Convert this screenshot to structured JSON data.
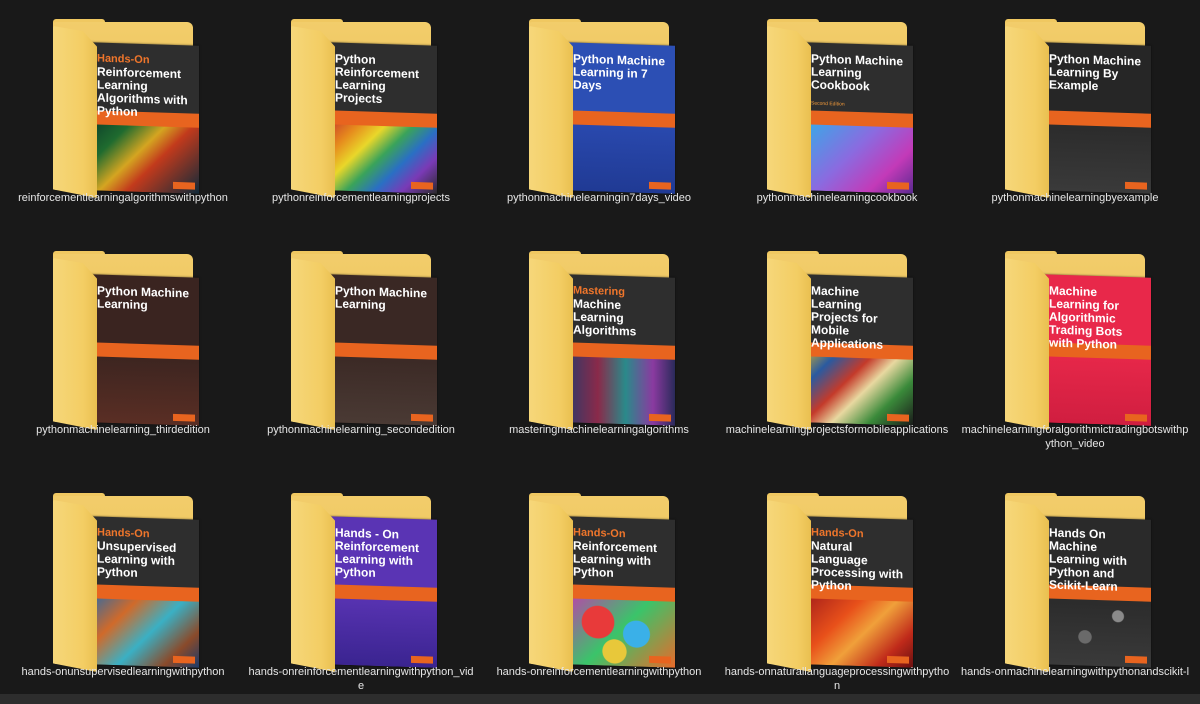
{
  "folders": [
    {
      "label": "reinforcementlearningalgorithmswithpython",
      "kicker": "Hands-On",
      "title": "Reinforcement Learning Algorithms with Python",
      "sub": "",
      "edition": "",
      "theme": {
        "bg": "#2e2e2e",
        "art": "linear-gradient(135deg,#0a3a2a 0%,#1f6b2f 25%,#d4a521 45%,#c23a1c 60%,#0f2a3a 100%)",
        "strip": "#2e2e2e"
      }
    },
    {
      "label": "pythonreinforcementlearningprojects",
      "kicker": "",
      "title": "Python Reinforcement Learning Projects",
      "sub": "",
      "edition": "",
      "theme": {
        "bg": "#2e2e2e",
        "art": "linear-gradient(135deg,#c4302b 0%,#e68a1d 20%,#e9d72a 35%,#3aa35a 50%,#2a6fc4 65%,#7a3ab6 80%,#2a2a2a 100%)",
        "strip": "#2e2e2e"
      }
    },
    {
      "label": "pythonmachinelearningin7days_video",
      "kicker": "",
      "title": "Python Machine Learning in 7 Days",
      "sub": "",
      "edition": "",
      "theme": {
        "bg": "#2c4fb4",
        "art": "linear-gradient(180deg,#2a4ab0 0%,#203a94 100%)",
        "strip": "#2c4fb4"
      }
    },
    {
      "label": "pythonmachinelearningcookbook",
      "kicker": "",
      "title": "Python Machine Learning Cookbook",
      "sub": "",
      "edition": "Second Edition",
      "theme": {
        "bg": "#2e2e2e",
        "art": "linear-gradient(135deg,#2fb0e8 0%,#8a6be0 45%,#c33ab8 75%,#5a2a90 100%)",
        "strip": "#2e2e2e"
      }
    },
    {
      "label": "pythonmachinelearningbyexample",
      "kicker": "",
      "title": "Python Machine Learning By Example",
      "sub": "",
      "edition": "",
      "theme": {
        "bg": "#262626",
        "art": "linear-gradient(180deg,#2a2a2a 0%,#3a3a3a 100%)",
        "strip": "#262626"
      }
    },
    {
      "label": "pythonmachinelearning_thirdedition",
      "kicker": "",
      "title": "Python Machine Learning",
      "sub": "",
      "edition": "",
      "theme": {
        "bg": "#3a2420",
        "art": "linear-gradient(180deg,#3a2420 0%,#5a2e24 100%)",
        "strip": "#3a2420"
      }
    },
    {
      "label": "pythonmachinelearning_secondedition",
      "kicker": "",
      "title": "Python Machine Learning",
      "sub": "",
      "edition": "",
      "theme": {
        "bg": "#3a2824",
        "art": "linear-gradient(180deg,#3a2824 0%,#4a3a34 100%)",
        "strip": "#3a2824"
      }
    },
    {
      "label": "masteringmachinelearningalgorithms",
      "kicker": "Mastering",
      "title": "Machine Learning Algorithms",
      "sub": "",
      "edition": "",
      "theme": {
        "bg": "#2e2e2e",
        "art": "linear-gradient(90deg,#2a3a6a 0%,#8a2a4a 30%,#2a8a8a 55%,#8a3aa0 80%,#2a2a5a 100%)",
        "strip": "#2e2e2e"
      }
    },
    {
      "label": "machinelearningprojectsformobileapplications",
      "kicker": "",
      "title": "Machine Learning Projects for Mobile Applications",
      "sub": "",
      "edition": "",
      "theme": {
        "bg": "#2e2e2e",
        "art": "linear-gradient(135deg,#d4b02a 0%,#2a5aa0 20%,#c43a2a 40%,#e8d8a0 55%,#3a8a3a 75%,#1a1a1a 100%)",
        "strip": "#2e2e2e"
      }
    },
    {
      "label": "machinelearningforalgorithmictradingbotswithpython_video",
      "kicker": "",
      "title": "Machine Learning for Algorithmic Trading Bots with Python",
      "sub": "",
      "edition": "",
      "theme": {
        "bg": "#e8284a",
        "art": "linear-gradient(180deg,#e8284a 0%,#d01e40 100%)",
        "strip": "#e8284a"
      }
    },
    {
      "label": "hands-onunsupervisedlearningwithpython",
      "kicker": "Hands-On",
      "title": "Unsupervised Learning with Python",
      "sub": "",
      "edition": "",
      "theme": {
        "bg": "#2e2e2e",
        "art": "linear-gradient(135deg,#1f6ab0 0%,#d06a2a 30%,#3ab0c4 55%,#8a4a2a 80%,#1a3a6a 100%)",
        "strip": "#2e2e2e"
      }
    },
    {
      "label": "hands-onreinforcementlearningwithpython_vide",
      "kicker": "",
      "title": "Hands - On Reinforcement Learning with Python",
      "sub": "",
      "edition": "",
      "theme": {
        "bg": "#5a34b4",
        "art": "linear-gradient(180deg,#5a34b4 0%,#3a2490 100%)",
        "strip": "#5a34b4"
      }
    },
    {
      "label": "hands-onreinforcementlearningwithpython",
      "kicker": "Hands-On",
      "title": "Reinforcement Learning with Python",
      "sub": "",
      "edition": "",
      "theme": {
        "bg": "#2e2e2e",
        "art": "radial-gradient(circle at 30% 40%,#e83a3a 0 18%,transparent 19%),radial-gradient(circle at 65% 55%,#3ab0e8 0 16%,transparent 17%),radial-gradient(circle at 45% 80%,#e8c83a 0 14%,transparent 15%),linear-gradient(135deg,#c43ab0 0%,#3ac46a 50%,#e86a2a 100%)",
        "strip": "#2e2e2e"
      }
    },
    {
      "label": "hands-onnaturallanguageprocessingwithpython",
      "kicker": "Hands-On",
      "title": "Natural Language Processing with Python",
      "sub": "",
      "edition": "",
      "theme": {
        "bg": "#2e2e2e",
        "art": "linear-gradient(135deg,#a01a1a 0%,#e8501a 35%,#f0a03a 55%,#c02a1a 80%,#6a1010 100%)",
        "strip": "#2e2e2e"
      }
    },
    {
      "label": "hands-onmachinelearningwithpythonandscikit-l",
      "kicker": "",
      "title": "Hands On Machine Learning with Python and Scikit-Learn",
      "sub": "",
      "edition": "",
      "theme": {
        "bg": "#2a2a2a",
        "art": "radial-gradient(circle at 70% 30%,#8a8a8a 0 6%,transparent 7%),radial-gradient(circle at 40% 60%,#6a6a6a 0 8%,transparent 9%),linear-gradient(180deg,#2a2a2a 0%,#3a3a3a 100%)",
        "strip": "#2a2a2a"
      }
    }
  ]
}
